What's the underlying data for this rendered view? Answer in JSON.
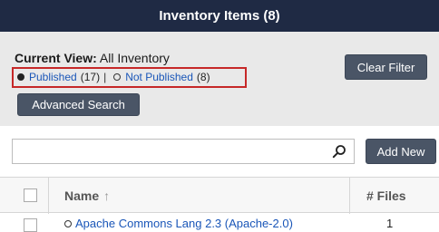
{
  "title": "Inventory Items (8)",
  "current_view": {
    "label": "Current View:",
    "value": "All Inventory"
  },
  "filters": {
    "published_label": "Published",
    "published_count": "(17)",
    "separator": "|",
    "not_published_label": "Not Published",
    "not_published_count": "(8)"
  },
  "buttons": {
    "clear_filter": "Clear Filter",
    "advanced_search": "Advanced Search",
    "add_new": "Add New"
  },
  "search": {
    "value": "",
    "placeholder": ""
  },
  "table": {
    "headers": {
      "name": "Name",
      "files": "# Files"
    },
    "rows": [
      {
        "name": "Apache Commons Lang 2.3 (Apache-2.0)",
        "files": "1"
      }
    ]
  },
  "colors": {
    "header_bg": "#1f2a44",
    "panel_bg": "#e9e9e9",
    "button_bg": "#4a5566",
    "link": "#1a56b8",
    "highlight": "#c62828"
  }
}
